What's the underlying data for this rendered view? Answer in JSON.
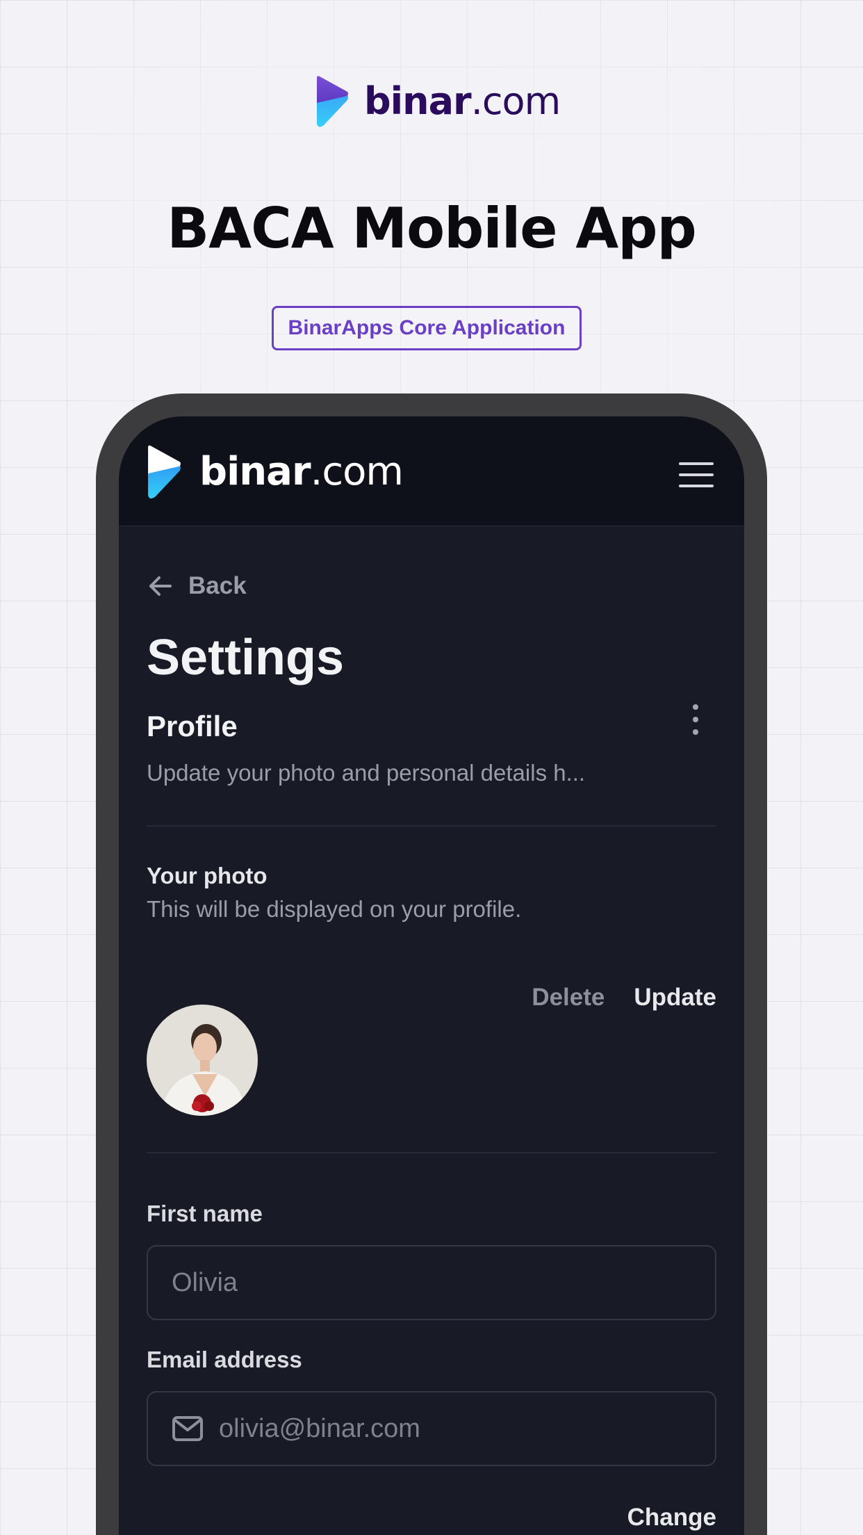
{
  "brand": {
    "name_bold": "binar",
    "name_light": ".com"
  },
  "hero": {
    "title": "BACA Mobile App",
    "badge": "BinarApps Core Application"
  },
  "app": {
    "header": {
      "logo_bold": "binar",
      "logo_light": ".com",
      "menu_icon": "hamburger-menu-icon"
    },
    "back_label": "Back",
    "page_title": "Settings",
    "profile": {
      "title": "Profile",
      "subtitle": "Update your photo and personal details h..."
    },
    "photo": {
      "title": "Your photo",
      "subtitle": "This will be displayed on your profile.",
      "delete_label": "Delete",
      "update_label": "Update"
    },
    "fields": {
      "first_name_label": "First name",
      "first_name_value": "Olivia",
      "email_label": "Email address",
      "email_value": "olivia@binar.com",
      "change_label": "Change"
    }
  },
  "colors": {
    "brand_purple": "#6a3fc5",
    "brand_dark": "#2b0b5c",
    "brand_cyan": "#35c6f4",
    "screen_bg": "#181b25",
    "frame": "#3c3c3e"
  }
}
